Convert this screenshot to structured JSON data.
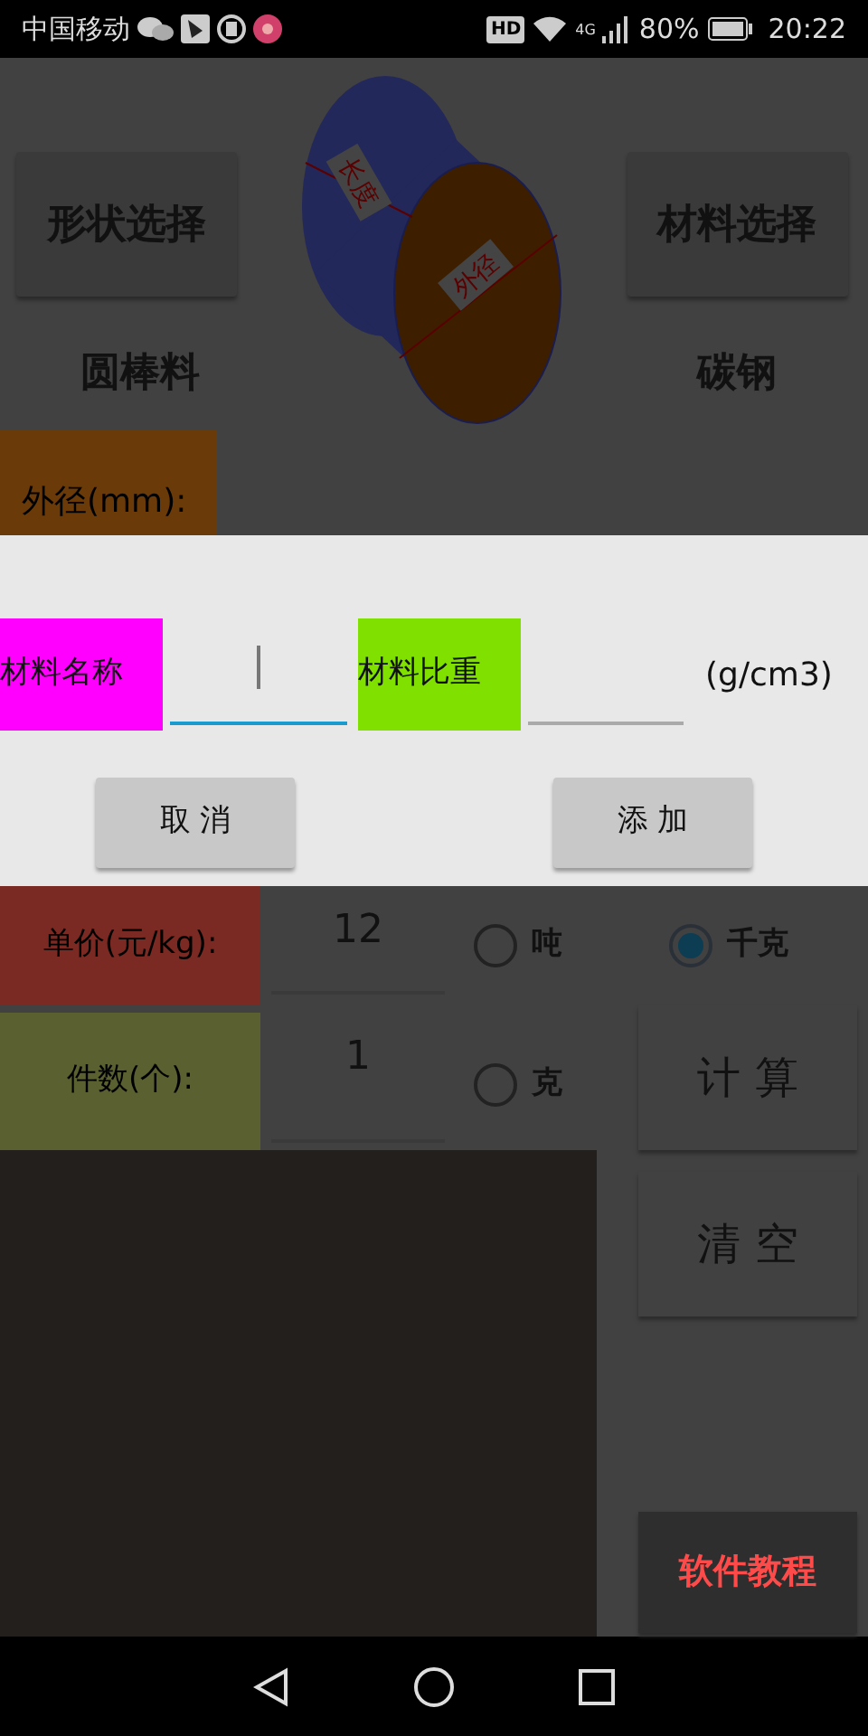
{
  "status_bar": {
    "carrier": "中国移动",
    "hd": "HD",
    "network": "4G",
    "battery": "80%",
    "time": "20:22"
  },
  "main": {
    "shape_button": "形状选择",
    "shape_value": "圆棒料",
    "material_button": "材料选择",
    "material_value": "碳钢",
    "diagram_labels": [
      "长度",
      "外径"
    ],
    "diameter_label": "外径(mm):"
  },
  "dialog": {
    "fields": [
      {
        "label": "材料名称",
        "color": "#ff00ff",
        "focused": true
      },
      {
        "label": "材料比重",
        "color": "#80e000",
        "focused": false,
        "unit": "(g/cm3)"
      }
    ],
    "buttons": [
      "取 消",
      "添 加"
    ]
  },
  "form": {
    "rows": [
      {
        "label": "单价(元/kg):",
        "color": "#7a2a22",
        "value": "12"
      },
      {
        "label": "件数(个):",
        "color": "#5a6030",
        "value": "1"
      }
    ],
    "units": [
      {
        "label": "吨",
        "selected": false
      },
      {
        "label": "千克",
        "selected": true
      },
      {
        "label": "克",
        "selected": false
      }
    ],
    "actions": [
      "计 算",
      "清 空"
    ],
    "tutorial": "软件教程"
  }
}
